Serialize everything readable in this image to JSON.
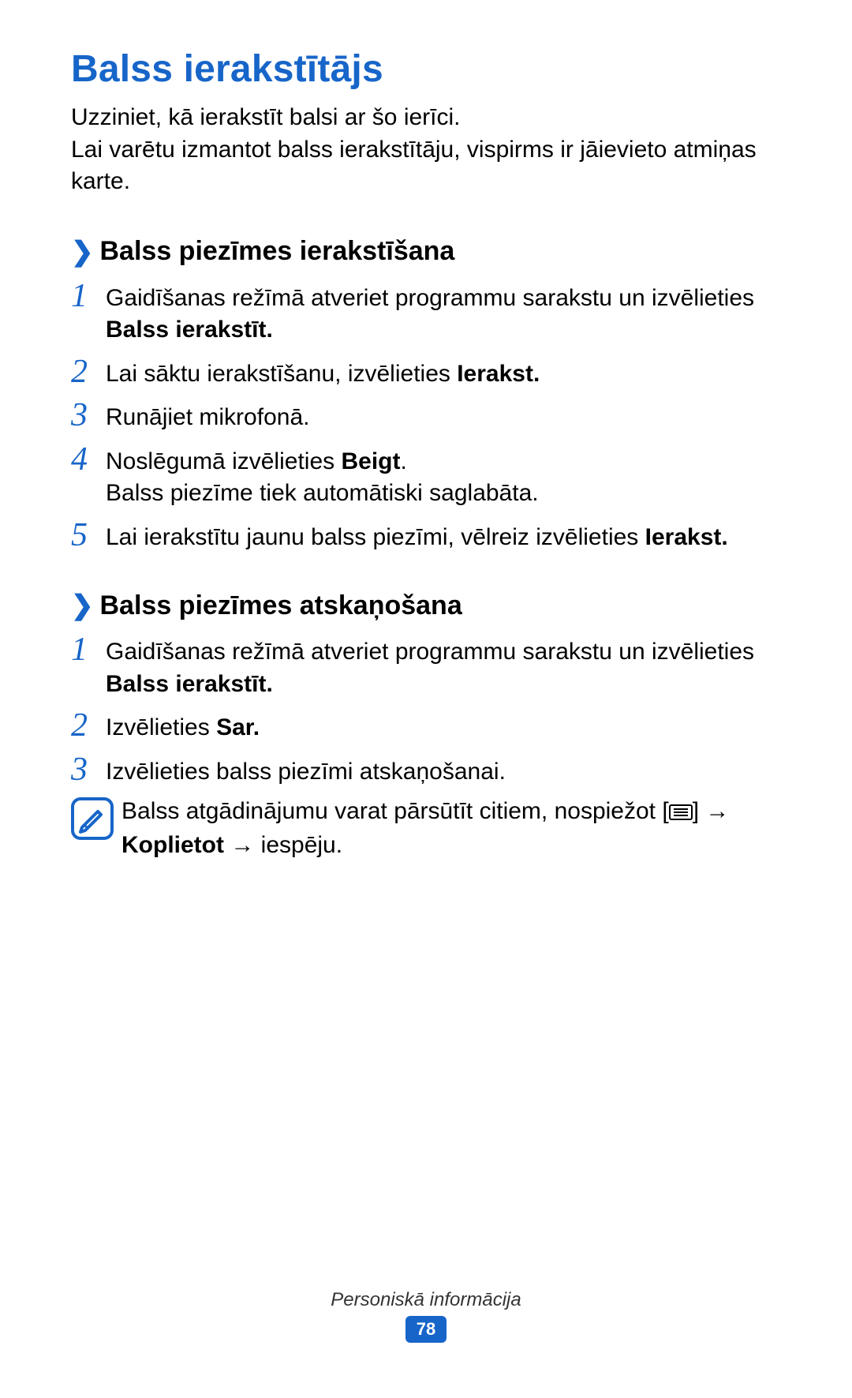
{
  "title": "Balss ierakstītājs",
  "intro": {
    "line1": "Uzziniet, kā ierakstīt balsi ar šo ierīci.",
    "line2": "Lai varētu izmantot balss ierakstītāju, vispirms ir jāievieto atmiņas karte."
  },
  "sections": [
    {
      "heading": "Balss piezīmes ierakstīšana",
      "steps": [
        {
          "num": "1",
          "pre": "Gaidīšanas režīmā atveriet programmu sarakstu un izvēlieties ",
          "bold": "Balss ierakstīt."
        },
        {
          "num": "2",
          "pre": "Lai sāktu ierakstīšanu, izvēlieties ",
          "bold": "Ierakst."
        },
        {
          "num": "3",
          "pre": "Runājiet mikrofonā."
        },
        {
          "num": "4",
          "pre": "Noslēgumā izvēlieties ",
          "bold": "Beigt",
          "post": ".",
          "line2": "Balss piezīme tiek automātiski saglabāta."
        },
        {
          "num": "5",
          "pre": "Lai ierakstītu jaunu balss piezīmi, vēlreiz izvēlieties ",
          "bold": "Ierakst."
        }
      ]
    },
    {
      "heading": "Balss piezīmes atskaņošana",
      "steps": [
        {
          "num": "1",
          "pre": "Gaidīšanas režīmā atveriet programmu sarakstu un izvēlieties ",
          "bold": "Balss ierakstīt."
        },
        {
          "num": "2",
          "pre": "Izvēlieties ",
          "bold": "Sar."
        },
        {
          "num": "3",
          "pre": "Izvēlieties balss piezīmi atskaņošanai."
        }
      ],
      "note": {
        "pre": "Balss atgādinājumu varat pārsūtīt citiem, nospiežot [",
        "post_bracket": "] → ",
        "bold": "Koplietot",
        "tail": " → iespēju."
      }
    }
  ],
  "footer": {
    "section_name": "Personiskā informācija",
    "page_number": "78"
  },
  "icons": {
    "note_icon": "pencil-note-icon",
    "menu_icon": "menu-icon"
  }
}
